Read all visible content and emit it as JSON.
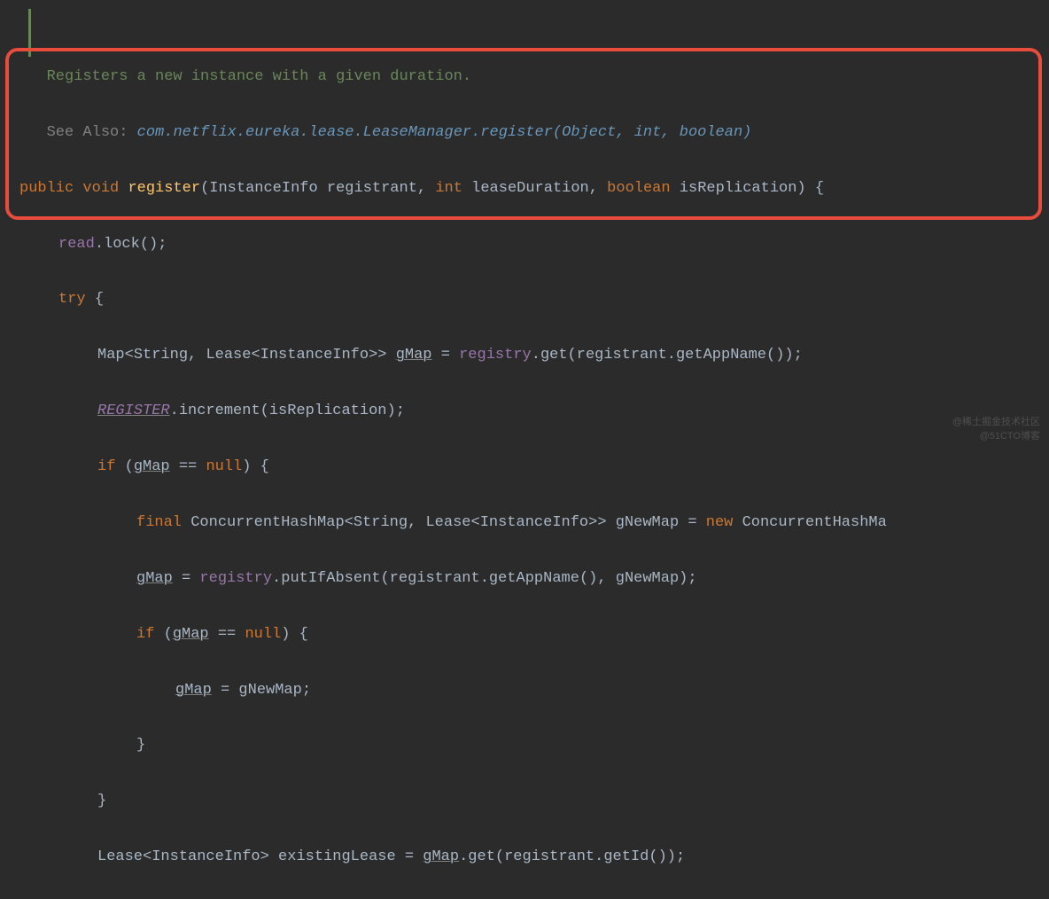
{
  "doc": {
    "line1": "Registers a new instance with a given duration.",
    "seeAlso": "See Also: ",
    "link": "com.netflix.eureka.lease.LeaseManager.register(Object, int, boolean)"
  },
  "code": {
    "kw_public": "public",
    "kw_void": "void",
    "fn_register": "register",
    "type_InstanceInfo": "InstanceInfo",
    "param_registrant": "registrant",
    "kw_int": "int",
    "param_leaseDuration": "leaseDuration",
    "kw_boolean": "boolean",
    "param_isReplication": "isReplication",
    "brace_open": "{",
    "brace_close": "}",
    "paren_open": "(",
    "paren_close": ")",
    "semicolon": ";",
    "comma": ", ",
    "dot": ".",
    "eq": " = ",
    "eqeq": " == ",
    "gt": ">",
    "lt": "<",
    "gtgt": ">>",
    "field_read": "read",
    "method_lock": "lock",
    "kw_try": "try",
    "type_Map": "Map",
    "type_String": "String",
    "type_Lease": "Lease",
    "var_gMap": "gMap",
    "field_registry": "registry",
    "method_get": "get",
    "method_getAppName": "getAppName",
    "static_REGISTER": "REGISTER",
    "method_increment": "increment",
    "kw_if": "if",
    "kw_null": "null",
    "kw_final": "final",
    "type_ConcurrentHashMap": "ConcurrentHashMap",
    "var_gNewMap": "gNewMap",
    "kw_new": "new",
    "type_ConcurrentHashMa_cut": "ConcurrentHashMa",
    "method_putIfAbsent": "putIfAbsent",
    "var_existingLease": "existingLease",
    "method_getId": "getId"
  },
  "watermark": {
    "line1": "@稀土掘金技术社区",
    "line2": "@51CTO博客"
  }
}
